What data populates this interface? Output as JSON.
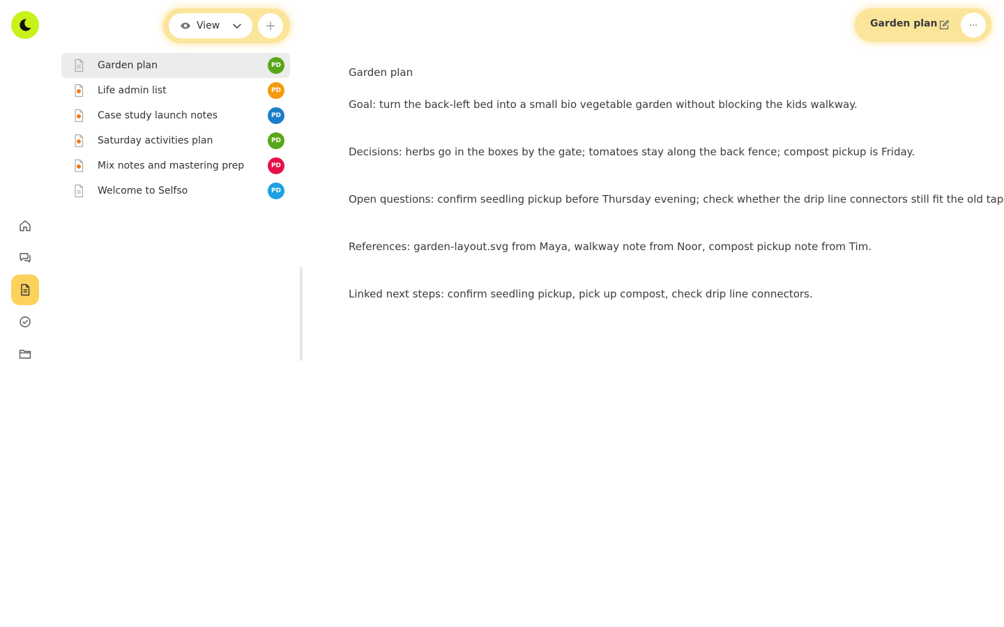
{
  "toolbar": {
    "view_label": "View"
  },
  "documents": [
    {
      "title": "Garden plan",
      "avatar": "PD",
      "avatar_color": "#5aa61a",
      "icon": "document-icon",
      "selected": true
    },
    {
      "title": "Life admin list",
      "avatar": "PD",
      "avatar_color": "#f59a0c",
      "icon": "document-draft-icon",
      "selected": false
    },
    {
      "title": "Case study launch notes",
      "avatar": "PD",
      "avatar_color": "#1a7ec9",
      "icon": "document-draft-icon",
      "selected": false
    },
    {
      "title": "Saturday activities plan",
      "avatar": "PD",
      "avatar_color": "#5aa61a",
      "icon": "document-draft-icon",
      "selected": false
    },
    {
      "title": "Mix notes and mastering prep",
      "avatar": "PD",
      "avatar_color": "#e5124a",
      "icon": "document-draft-icon",
      "selected": false
    },
    {
      "title": "Welcome to Selfso",
      "avatar": "PD",
      "avatar_color": "#1da1e2",
      "icon": "document-icon",
      "selected": false
    }
  ],
  "doc_header": {
    "title": "Garden plan"
  },
  "editor": {
    "heading": "Garden plan",
    "paragraphs": [
      "Goal: turn the back-left bed into a small bio vegetable garden without blocking the kids walkway.",
      "Decisions: herbs go in the boxes by the gate; tomatoes stay along the back fence; compost pickup is Friday.",
      "Open questions: confirm seedling pickup before Thursday evening; check whether the drip line connectors still fit the old tap.",
      "References: garden-layout.svg from Maya, walkway note from Noor, compost pickup note from Tim.",
      "Linked next steps: confirm seedling pickup, pick up compost, check drip line connectors."
    ]
  },
  "colors": {
    "accent": "#fcd15c",
    "logo": "#c8f21a"
  }
}
